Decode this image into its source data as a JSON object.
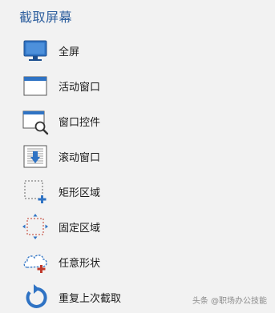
{
  "panel": {
    "title": "截取屏幕",
    "accent_color": "#2e5f9e",
    "items": [
      {
        "label": "全屏",
        "icon": "monitor-icon"
      },
      {
        "label": "活动窗口",
        "icon": "window-icon"
      },
      {
        "label": "窗口控件",
        "icon": "window-magnifier-icon"
      },
      {
        "label": "滚动窗口",
        "icon": "scroll-window-icon"
      },
      {
        "label": "矩形区域",
        "icon": "rectangle-region-icon"
      },
      {
        "label": "固定区域",
        "icon": "fixed-region-icon"
      },
      {
        "label": "任意形状",
        "icon": "freeform-cloud-icon"
      },
      {
        "label": "重复上次截取",
        "icon": "repeat-capture-icon"
      }
    ]
  },
  "watermark": {
    "text": "头条 @职场办公技能"
  }
}
